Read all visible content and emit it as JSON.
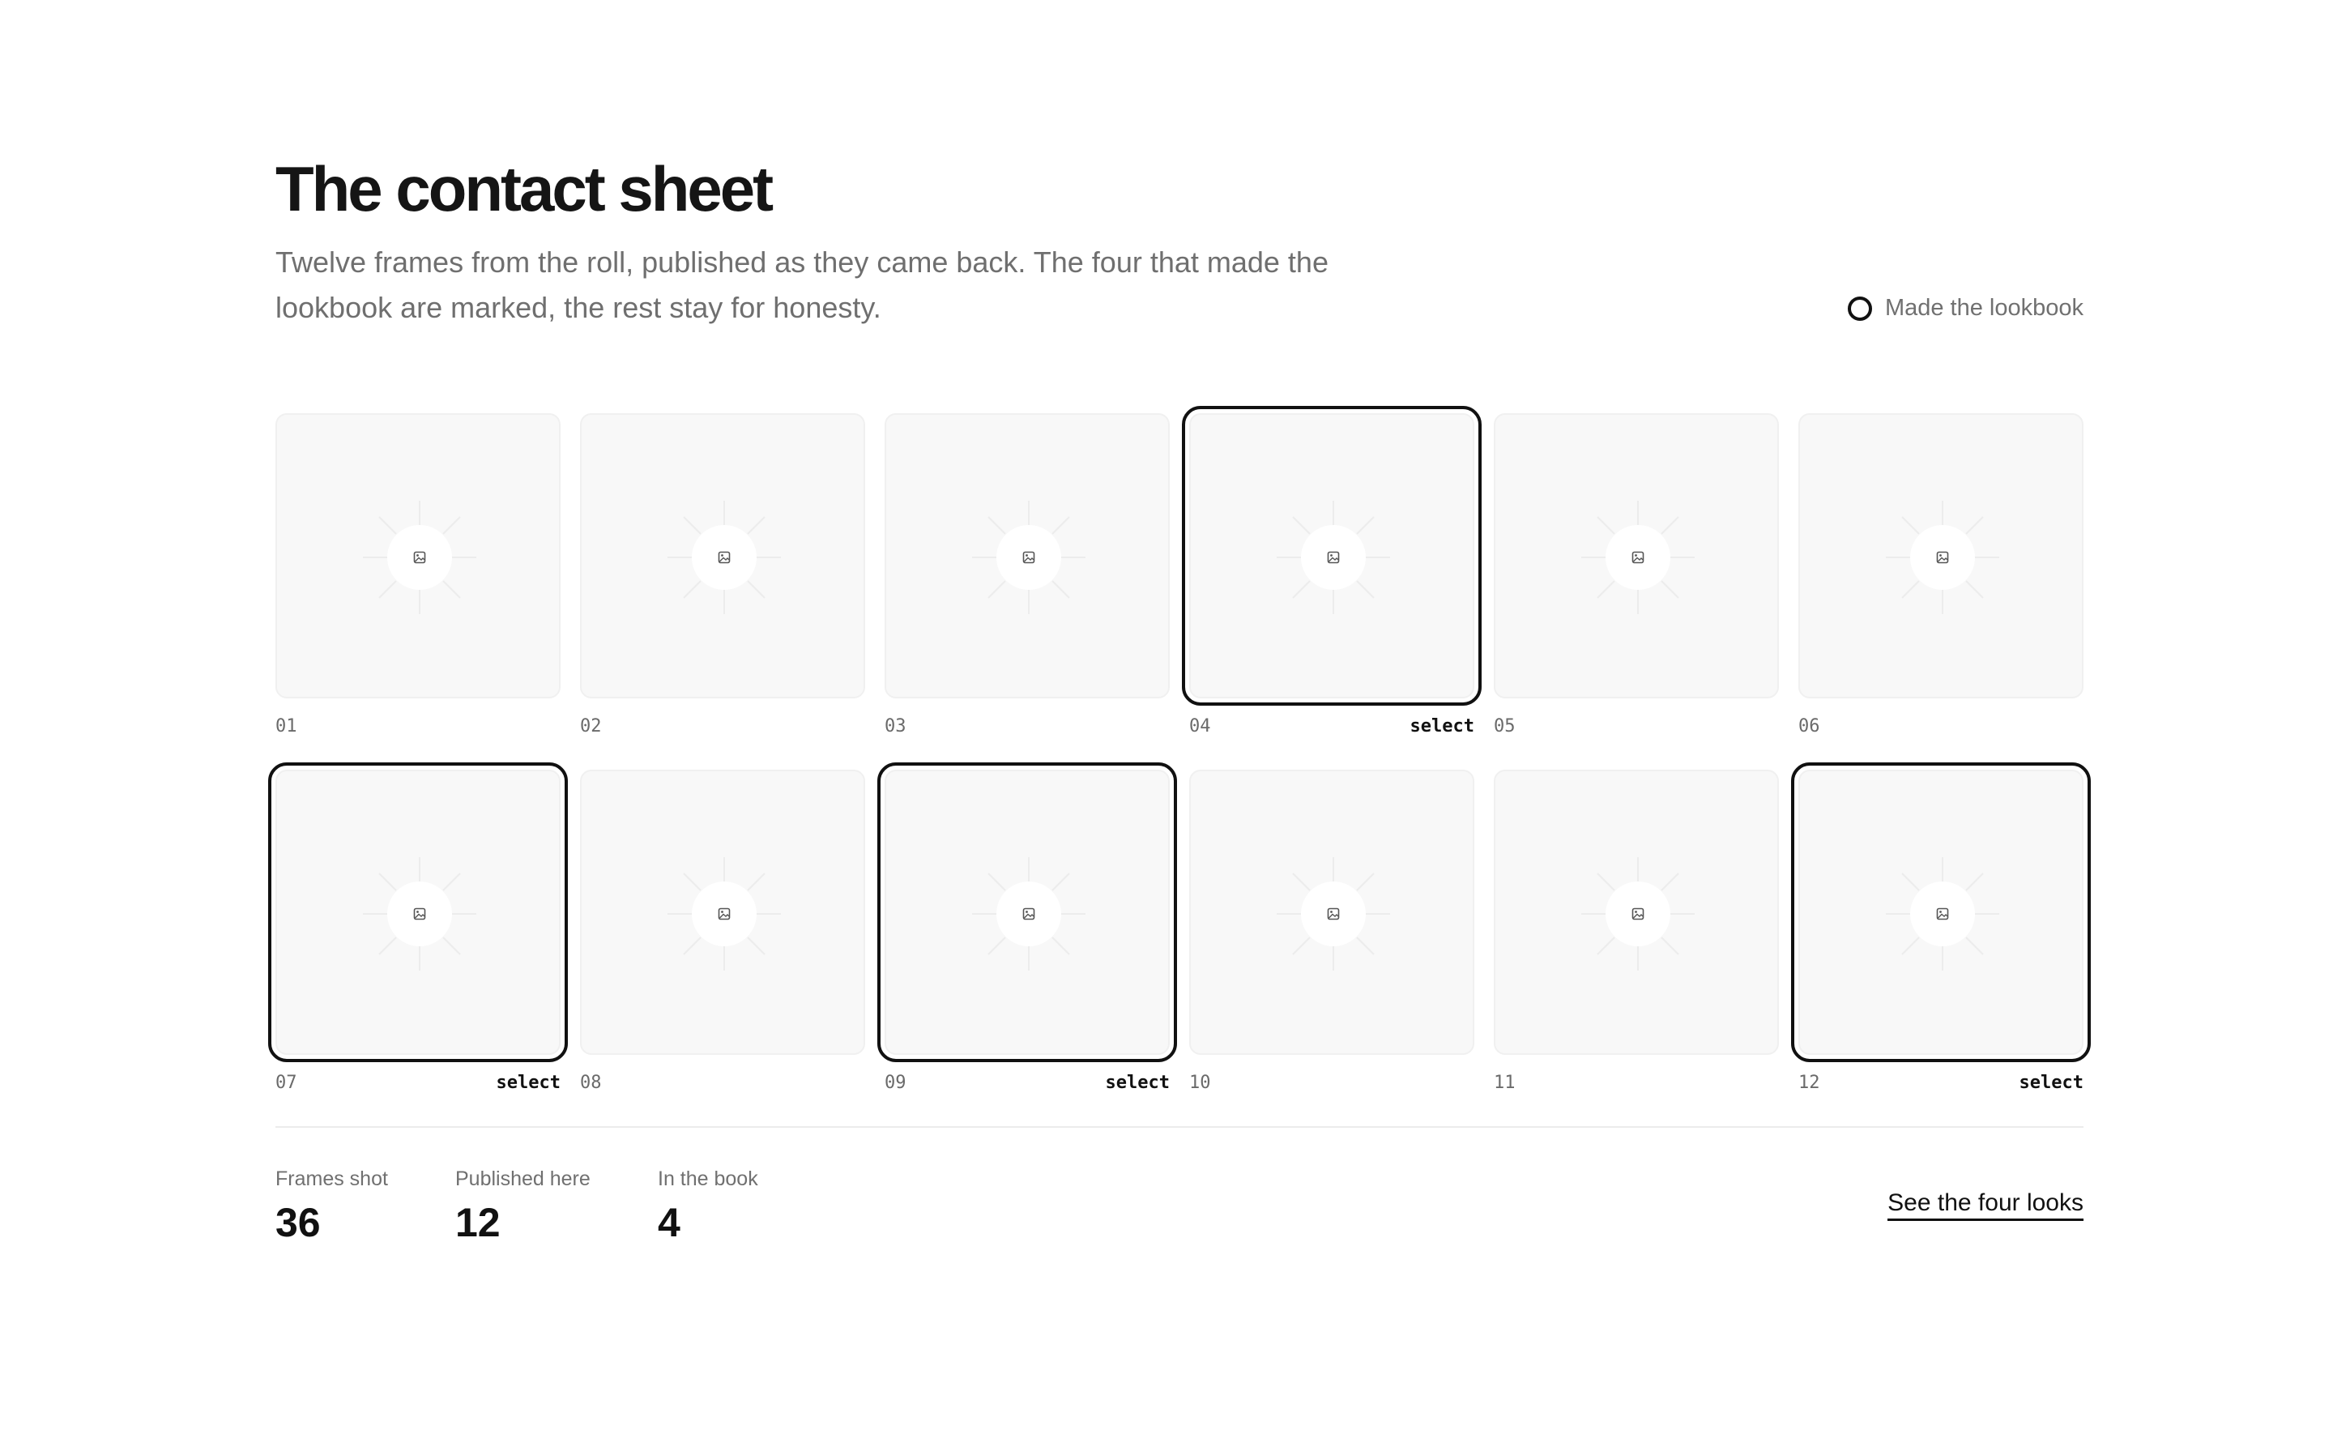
{
  "header": {
    "title": "The contact sheet",
    "subtitle": "Twelve frames from the roll, published as they came back. The four that made the lookbook are marked, the rest stay for honesty."
  },
  "legend": {
    "label": "Made the lookbook",
    "icon": "ring-icon"
  },
  "frames": [
    {
      "number": "01",
      "selected": false,
      "tag": ""
    },
    {
      "number": "02",
      "selected": false,
      "tag": ""
    },
    {
      "number": "03",
      "selected": false,
      "tag": ""
    },
    {
      "number": "04",
      "selected": true,
      "tag": "select"
    },
    {
      "number": "05",
      "selected": false,
      "tag": ""
    },
    {
      "number": "06",
      "selected": false,
      "tag": ""
    },
    {
      "number": "07",
      "selected": true,
      "tag": "select"
    },
    {
      "number": "08",
      "selected": false,
      "tag": ""
    },
    {
      "number": "09",
      "selected": true,
      "tag": "select"
    },
    {
      "number": "10",
      "selected": false,
      "tag": ""
    },
    {
      "number": "11",
      "selected": false,
      "tag": ""
    },
    {
      "number": "12",
      "selected": true,
      "tag": "select"
    }
  ],
  "stats": [
    {
      "label": "Frames shot",
      "value": "36"
    },
    {
      "label": "Published here",
      "value": "12"
    },
    {
      "label": "In the book",
      "value": "4"
    }
  ],
  "cta": {
    "label": "See the four looks"
  },
  "colors": {
    "accent": "#111111",
    "muted_text": "#6f6f6f",
    "tile_bg": "#f8f8f8",
    "divider": "#ececec"
  }
}
